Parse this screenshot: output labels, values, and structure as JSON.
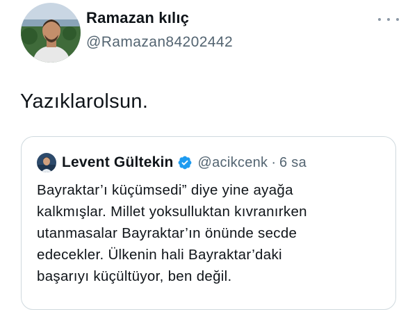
{
  "tweet": {
    "author": {
      "display_name": "Ramazan kılıç",
      "handle": "@Ramazan84202442",
      "avatar_icon": "profile-photo"
    },
    "more_icon": "more-options-icon",
    "text": "Yazıklarolsun."
  },
  "quoted_tweet": {
    "author": {
      "display_name": "Levent Gültekin",
      "handle": "@acikcenk",
      "verified": true,
      "avatar_icon": "profile-photo"
    },
    "separator": "·",
    "time": "6 sa",
    "text_lines": [
      "Bayraktar’ı küçümsedi” diye yine ayağa",
      "kalkmışlar. Millet yoksulluktan kıvranırken",
      "utanmasalar Bayraktar’ın önünde secde",
      "edecekler. Ülkenin hali Bayraktar’daki",
      "başarıyı küçültüyor, ben değil."
    ]
  },
  "colors": {
    "text_primary": "#0f1419",
    "text_secondary": "#536471",
    "border": "#cfd9de",
    "verified_blue": "#1d9bf0"
  }
}
